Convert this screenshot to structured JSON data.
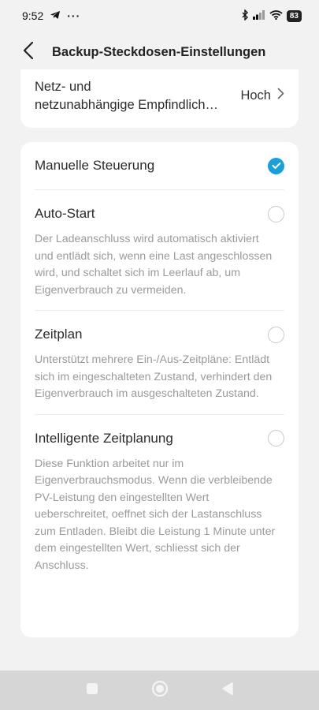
{
  "status_bar": {
    "time": "9:52",
    "dots": "···",
    "battery": "83"
  },
  "header": {
    "title": "Backup-Steckdosen-Einstellungen"
  },
  "top_setting": {
    "label_line1": "Netz- und",
    "label_line2": "netzunabhängige Empfindlichkeit",
    "value": "Hoch"
  },
  "options": [
    {
      "title": "Manuelle Steuerung",
      "selected": true,
      "description": ""
    },
    {
      "title": "Auto-Start",
      "selected": false,
      "description": "Der Ladeanschluss wird automatisch aktiviert und entlädt sich, wenn eine Last angeschlossen wird, und schaltet sich im Leerlauf ab, um Eigenverbrauch zu vermeiden."
    },
    {
      "title": "Zeitplan",
      "selected": false,
      "description": "Unterstützt mehrere Ein-/Aus-Zeitpläne: Entlädt sich im eingeschalteten Zustand, verhindert den Eigenverbrauch im ausgeschalteten Zustand."
    },
    {
      "title": "Intelligente Zeitplanung",
      "selected": false,
      "description": "Diese Funktion arbeitet nur im Eigenverbrauchsmodus. Wenn die verbleibende PV-Leistung den eingestellten Wert ueberschreitet, oeffnet sich der Lastanschluss zum Entladen. Bleibt die Leistung 1 Minute unter dem eingestellten Wert, schliesst sich der Anschluss."
    }
  ],
  "colors": {
    "accent": "#1a9fd8",
    "background": "#f2f2f2",
    "card": "#ffffff",
    "description_text": "#9a9a9a",
    "nav_bar": "#d6d6d6"
  },
  "icons": {
    "back": "chevron-left-icon",
    "row_arrow": "chevron-right-icon",
    "selected": "check-circle-icon",
    "nav_recents": "square-icon",
    "nav_home": "circle-icon",
    "nav_back": "triangle-back-icon"
  }
}
